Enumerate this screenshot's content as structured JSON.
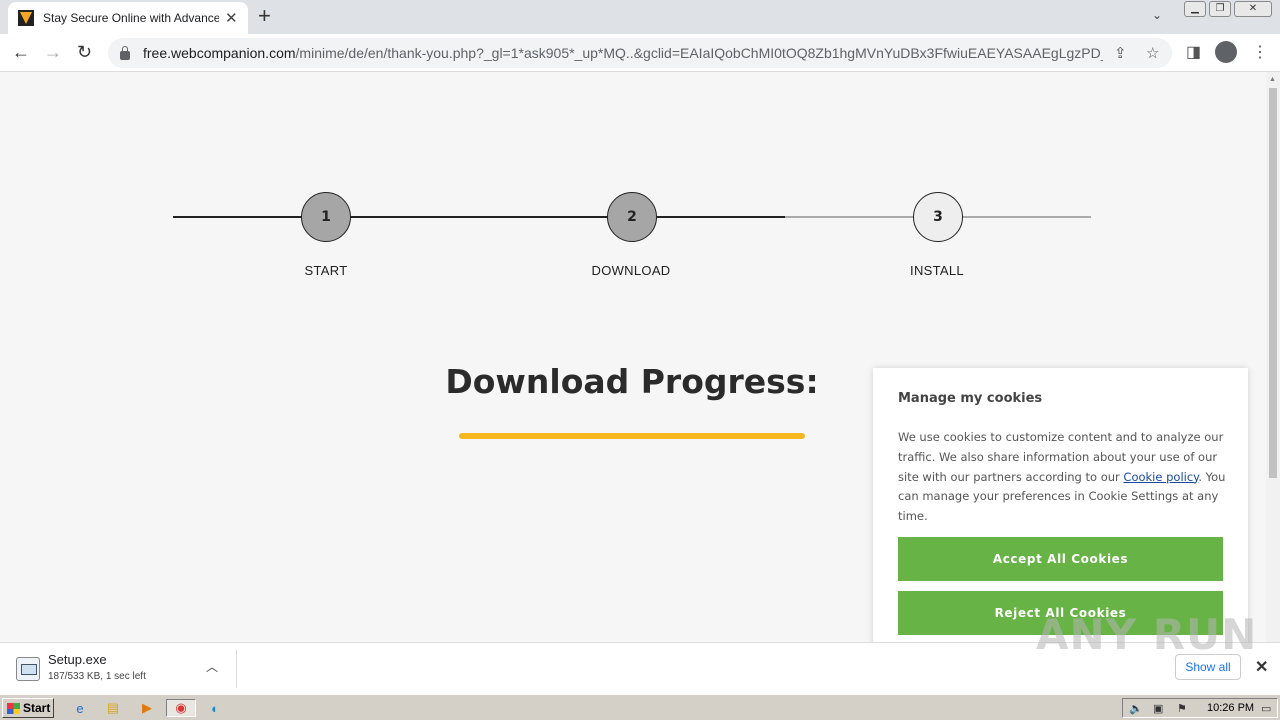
{
  "browser": {
    "tab_title": "Stay Secure Online with Advanced A",
    "url_host": "free.webcompanion.com",
    "url_path": "/minime/de/en/thank-you.php?_gl=1*ask905*_up*MQ..&gclid=EAIaIQobChMI0tOQ8Zb1hgMVnYuDBx3FfwiuEAEYASAAEgLgzPD_..."
  },
  "steps": [
    {
      "number": "1",
      "label": "START"
    },
    {
      "number": "2",
      "label": "DOWNLOAD"
    },
    {
      "number": "3",
      "label": "INSTALL"
    }
  ],
  "main": {
    "heading": "Download Progress:",
    "progress_fraction": 1.0
  },
  "cookie_banner": {
    "title": "Manage my cookies",
    "text_before_link": "We use cookies to customize content and to analyze our traffic. We also share information about your use of our site with our partners according to our ",
    "link_text": "Cookie policy",
    "text_after_link": ". You can manage your preferences in Cookie Settings at any time.",
    "accept_label": "Accept All Cookies",
    "reject_label": "Reject All Cookies"
  },
  "download_bar": {
    "file_name": "Setup.exe",
    "status": "187/533 KB, 1 sec left",
    "show_all_label": "Show all"
  },
  "watermark": "ANY RUN",
  "taskbar": {
    "start_label": "Start",
    "clock": "10:26 PM"
  },
  "colors": {
    "progress": "#f6b820",
    "cookie_button": "#67b345",
    "step_done": "#a6a6a6",
    "step_pending": "#eeeeee"
  }
}
